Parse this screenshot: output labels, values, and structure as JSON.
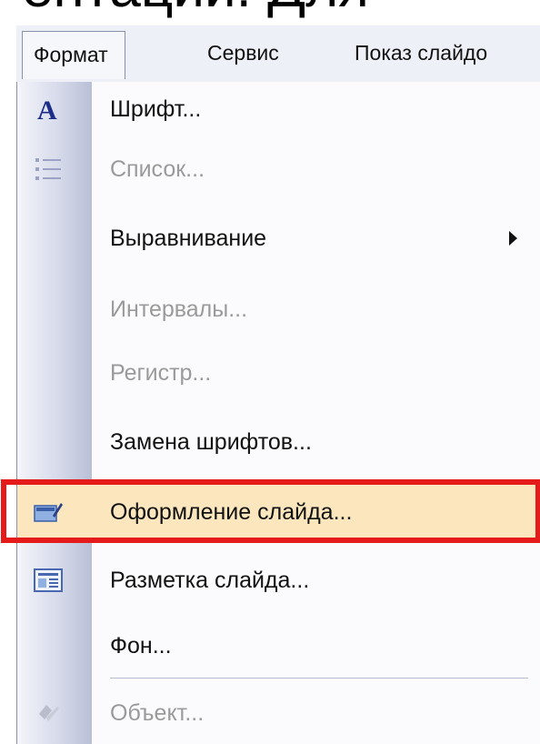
{
  "background_text": "ентации. Для",
  "menubar": {
    "items": [
      "Формат",
      "Сервис",
      "Показ слайдо"
    ]
  },
  "menu": {
    "items": [
      {
        "label": "Шрифт...",
        "icon": "font-a-icon",
        "enabled": true
      },
      {
        "label": "Список...",
        "icon": "list-icon",
        "enabled": false
      },
      {
        "label": "Выравнивание",
        "submenu": true,
        "enabled": true
      },
      {
        "label": "Интервалы...",
        "enabled": false
      },
      {
        "label": "Регистр...",
        "enabled": false
      },
      {
        "label": "Замена шрифтов...",
        "enabled": true
      },
      {
        "label": "Оформление слайда...",
        "icon": "slide-design-icon",
        "enabled": true,
        "highlighted": true
      },
      {
        "label": "Разметка слайда...",
        "icon": "slide-layout-icon",
        "enabled": true
      },
      {
        "label": "Фон...",
        "enabled": true
      },
      {
        "label": "Объект...",
        "icon": "object-icon",
        "enabled": false
      }
    ]
  },
  "colors": {
    "highlight_fill": "#fbe6bd",
    "annotation_red": "#e51b1b",
    "disabled_text": "#9a9a9a"
  }
}
